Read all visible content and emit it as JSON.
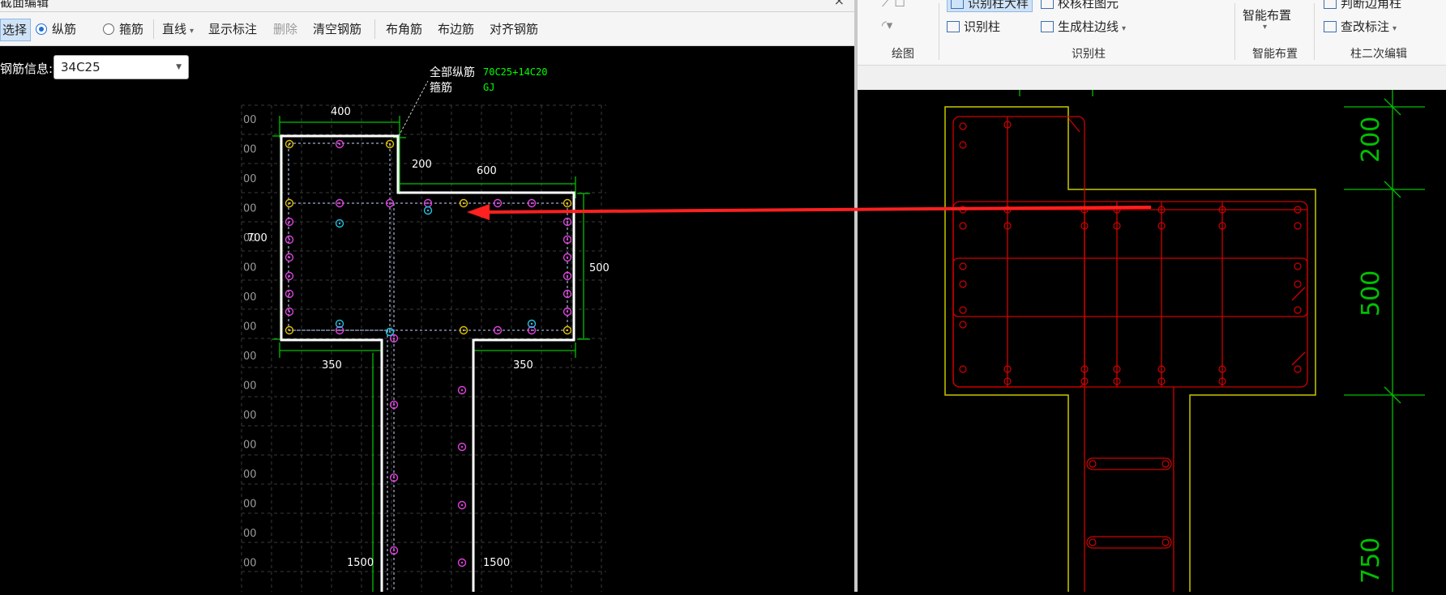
{
  "dialog": {
    "title": "截面编辑",
    "close": "×",
    "toolbar": {
      "select": "选择",
      "longitudinal": "纵筋",
      "stirrup": "箍筋",
      "line": "直线",
      "show_labels": "显示标注",
      "delete": "删除",
      "clear": "清空钢筋",
      "corner": "布角筋",
      "edge": "布边筋",
      "align": "对齐钢筋"
    },
    "rebar_info_label": "钢筋信息:",
    "rebar_info_value": "34C25",
    "annotation": {
      "all_long_label": "全部纵筋",
      "all_long_value": "70C25+14C20",
      "stirrup_label": "箍筋",
      "stirrup_value": "GJ"
    },
    "dims": {
      "top_400": "400",
      "d200": "200",
      "d600": "600",
      "left_700": "700",
      "right_500": "500",
      "bl_350": "350",
      "br_350": "350",
      "b1500_l": "1500",
      "b1500_r": "1500"
    },
    "grid_labels": [
      "00",
      "00",
      "00",
      "00",
      "00",
      "00",
      "00",
      "00",
      "00",
      "00",
      "00",
      "00",
      "00",
      "00",
      "00",
      "00",
      "00",
      "00",
      "00",
      "00"
    ]
  },
  "ribbon": {
    "row1": [
      "识别柱大样",
      "校核柱图元",
      "智能布置",
      "判断边角柱"
    ],
    "row2": [
      "识别柱",
      "生成柱边线",
      "查改标注"
    ],
    "groups": [
      "绘图",
      "识别柱",
      "智能布置",
      "柱二次编辑"
    ]
  },
  "cad_dims": [
    "200",
    "500",
    "750"
  ],
  "colors": {
    "accent_red": "#ff2020",
    "cad_red": "#d00000",
    "cad_yellow": "#c8c800",
    "dim_green": "#00c000",
    "rebar_magenta": "#e040e0",
    "rebar_yellow": "#e0c000",
    "rebar_cyan": "#20c0e0"
  }
}
